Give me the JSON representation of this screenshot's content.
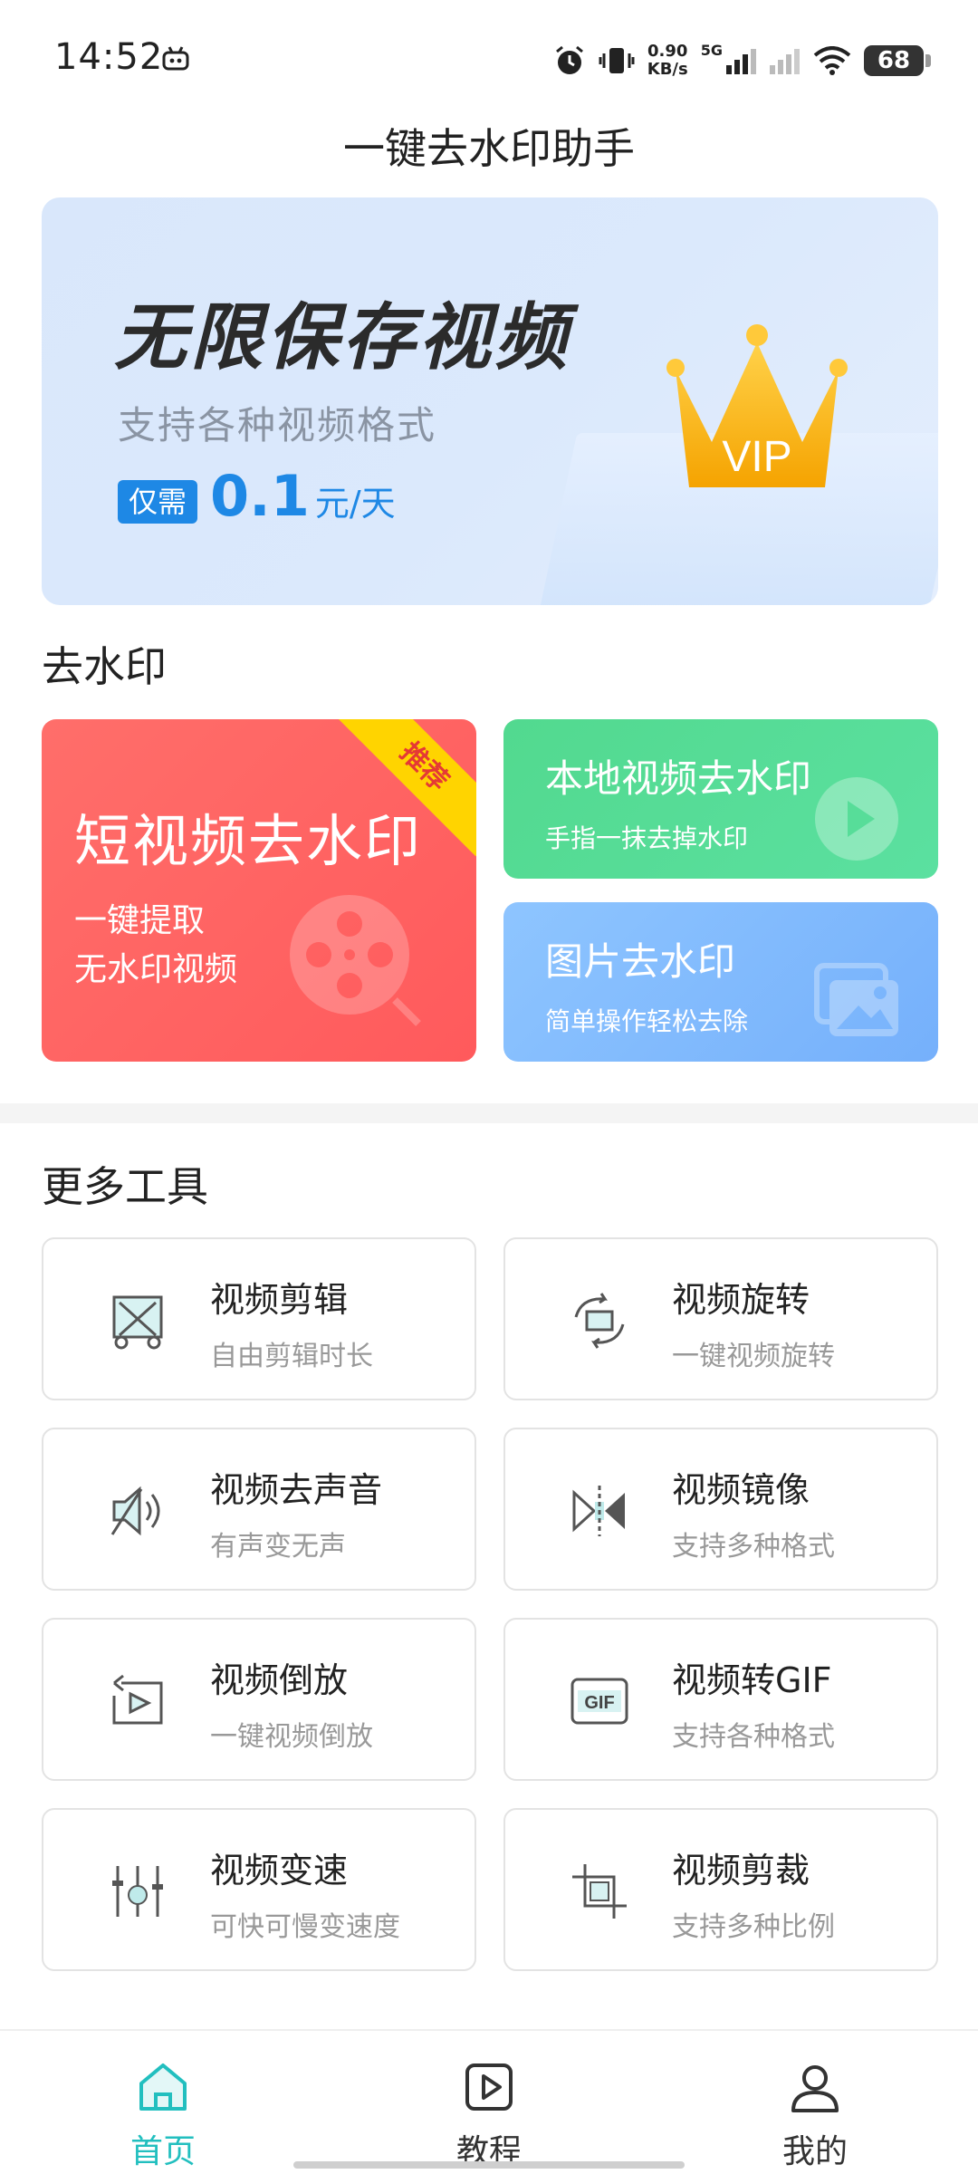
{
  "status_bar": {
    "time": "14:52",
    "net_speed_value": "0.90",
    "net_speed_unit": "KB/s",
    "network_type": "5G",
    "battery": "68"
  },
  "header": {
    "title": "一键去水印助手"
  },
  "banner": {
    "title": "无限保存视频",
    "subtitle": "支持各种视频格式",
    "price_tag": "仅需",
    "price_value": "0.1",
    "price_unit": "元/天",
    "crown_text": "VIP"
  },
  "watermark_section": {
    "title": "去水印",
    "short_video": {
      "title": "短视频去水印",
      "description": "一键提取\n无水印视频",
      "ribbon": "推荐"
    },
    "local_video": {
      "title": "本地视频去水印",
      "description": "手指一抹去掉水印"
    },
    "image": {
      "title": "图片去水印",
      "description": "简单操作轻松去除"
    }
  },
  "tools_section": {
    "title": "更多工具",
    "items": [
      {
        "name": "视频剪辑",
        "desc": "自由剪辑时长",
        "icon": "video-cut-icon"
      },
      {
        "name": "视频旋转",
        "desc": "一键视频旋转",
        "icon": "rotate-icon"
      },
      {
        "name": "视频去声音",
        "desc": "有声变无声",
        "icon": "speaker-icon"
      },
      {
        "name": "视频镜像",
        "desc": "支持多种格式",
        "icon": "mirror-icon"
      },
      {
        "name": "视频倒放",
        "desc": "一键视频倒放",
        "icon": "reverse-play-icon"
      },
      {
        "name": "视频转GIF",
        "desc": "支持各种格式",
        "icon": "gif-icon"
      },
      {
        "name": "视频变速",
        "desc": "可快可慢变速度",
        "icon": "speed-sliders-icon"
      },
      {
        "name": "视频剪裁",
        "desc": "支持多种比例",
        "icon": "crop-icon"
      }
    ]
  },
  "bottom_nav": {
    "home": "首页",
    "tutorial": "教程",
    "mine": "我的"
  },
  "colors": {
    "accent": "#22bfbf",
    "price_blue": "#1e88e5",
    "card_red": "#ff5e5e",
    "card_green": "#55db94",
    "card_blue": "#80bafd"
  }
}
